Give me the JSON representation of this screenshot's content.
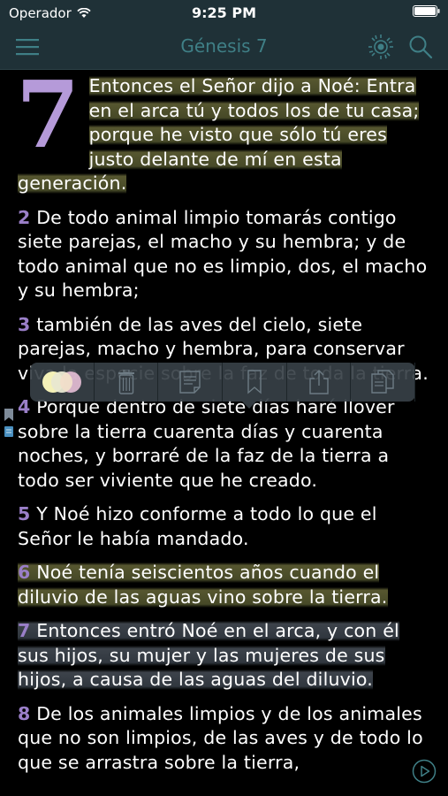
{
  "status": {
    "carrier": "Operador",
    "time": "9:25 PM"
  },
  "nav": {
    "title": "Génesis 7"
  },
  "chapter": {
    "dropcap": "7",
    "verse1_lines": [
      "Entonces el Señor dijo a Noé: Entra",
      "en el arca tú y todos los de tu casa;",
      "porque he visto que sólo tú eres",
      "justo delante de mí en esta generación."
    ],
    "verses": [
      {
        "num": "2",
        "text": "De todo animal limpio tomarás contigo siete parejas, el macho y su hembra; y de todo animal que no es limpio, dos, el macho y su hembra;"
      },
      {
        "num": "3",
        "text": "también de las aves del cielo, siete parejas, macho y hembra, para conservar viva la especie sobre la faz de toda la tierra."
      },
      {
        "num": "4",
        "text": "Porque dentro de siete días haré llover sobre la tierra cuarenta días y cuarenta noches, y borraré de la faz de la tierra a todo ser viviente que he creado."
      },
      {
        "num": "5",
        "text": "Y Noé hizo conforme a todo lo que el Señor le había mandado."
      },
      {
        "num": "6",
        "text": "Noé tenía seiscientos años cuando el diluvio de las aguas vino sobre la tierra."
      },
      {
        "num": "7",
        "text": "Entonces entró Noé en el arca, y con él sus hijos, su mujer y las mujeres de sus hijos, a causa de las aguas del diluvio."
      },
      {
        "num": "8",
        "text": "De los animales limpios y de los animales que no son limpios, de las aves y de todo lo que se arrastra sobre la tierra,"
      }
    ]
  },
  "toolbar": {
    "icons": [
      "color-picker-icon",
      "trash-icon",
      "note-icon",
      "bookmark-icon",
      "share-icon",
      "copy-icon"
    ]
  },
  "colors": {
    "nav_bg": "#1f3137",
    "title": "#3f7f86",
    "verse_number": "#9a7fc8",
    "highlight_yellow": "#787842",
    "highlight_blue": "#4e5660"
  }
}
